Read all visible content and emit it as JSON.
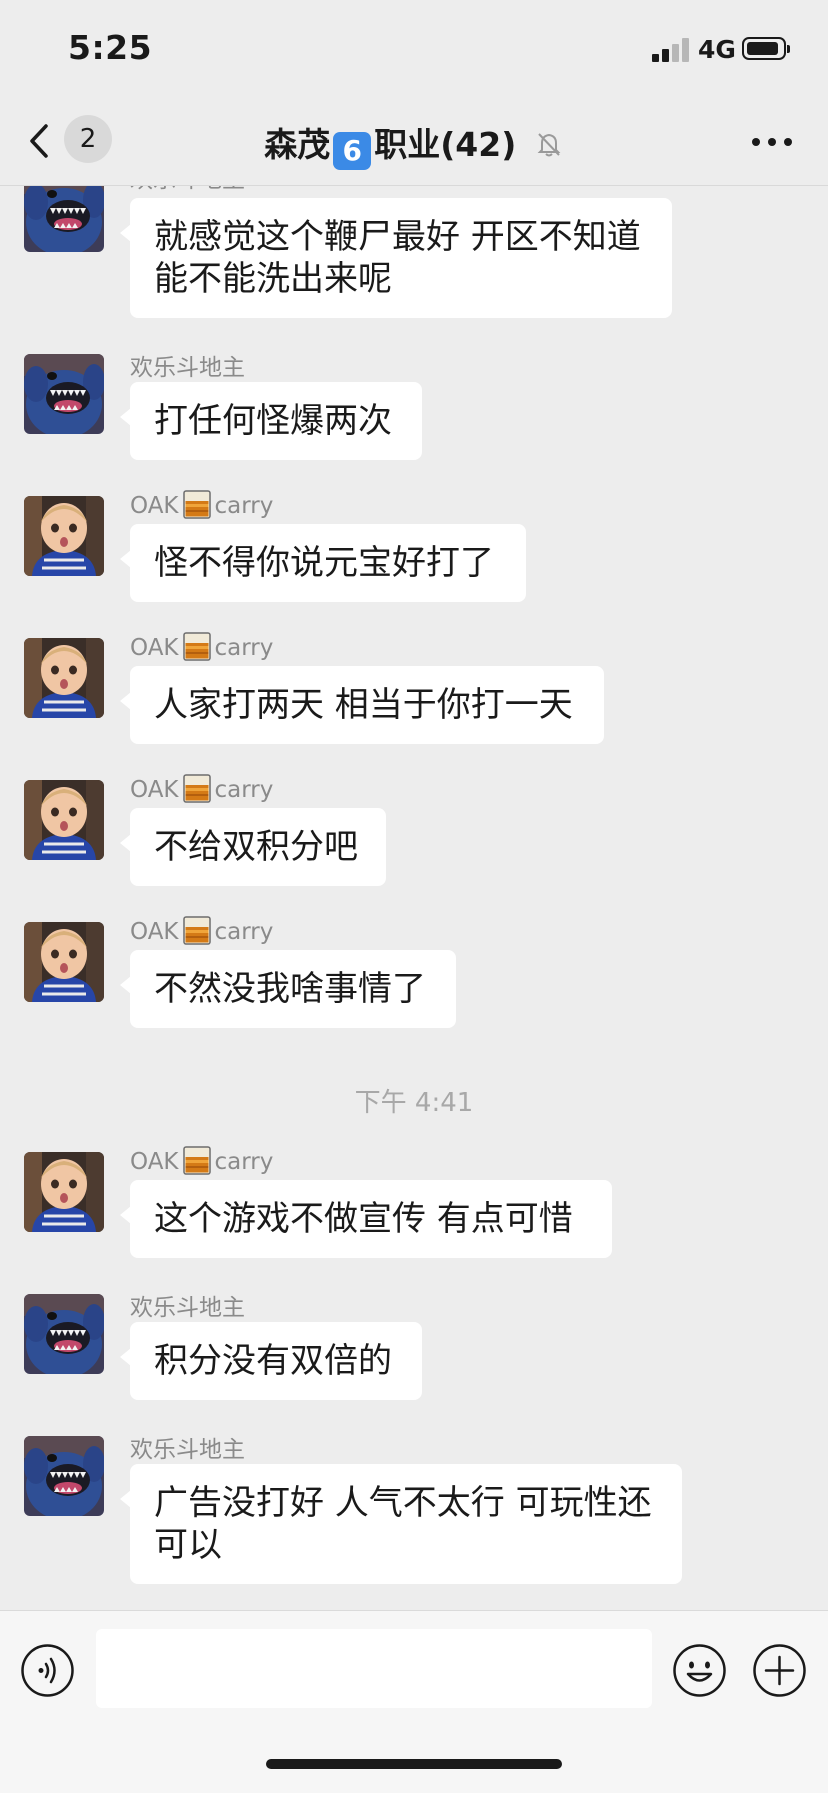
{
  "status_bar": {
    "time": "5:25",
    "network": "4G"
  },
  "nav": {
    "unread_count": "2",
    "title_prefix": "森茂",
    "title_number": "6",
    "title_suffix": "职业(42)"
  },
  "messages": [
    {
      "sender": "欢乐斗地主",
      "line1": "就感觉这个鞭尸最好 开区不知道",
      "line2": "能不能洗出来呢"
    },
    {
      "sender": "欢乐斗地主",
      "text": "打任何怪爆两次"
    },
    {
      "sender_a": "OAK",
      "sender_b": "carry",
      "text": "怪不得你说元宝好打了"
    },
    {
      "sender_a": "OAK",
      "sender_b": "carry",
      "text": "人家打两天 相当于你打一天"
    },
    {
      "sender_a": "OAK",
      "sender_b": "carry",
      "text": "不给双积分吧"
    },
    {
      "sender_a": "OAK",
      "sender_b": "carry",
      "text": "不然没我啥事情了"
    },
    {
      "sender_a": "OAK",
      "sender_b": "carry",
      "text": "这个游戏不做宣传  有点可惜"
    },
    {
      "sender": "欢乐斗地主",
      "text": "积分没有双倍的"
    },
    {
      "sender": "欢乐斗地主",
      "line1": "广告没打好 人气不太行 可玩性还",
      "line2": "可以"
    }
  ],
  "timestamp": "下午 4:41",
  "input": {
    "value": ""
  },
  "icons": {
    "back": "chevron-left-icon",
    "mute": "bell-off-icon",
    "more": "more-icon",
    "voice": "voice-icon",
    "emoji": "emoji-icon",
    "plus": "plus-icon",
    "sender_emoji": "whisky-glass-icon"
  },
  "colors": {
    "background": "#ededed",
    "bubble": "#ffffff",
    "number_badge": "#3b8ae6",
    "input_bar": "#f6f6f6"
  }
}
